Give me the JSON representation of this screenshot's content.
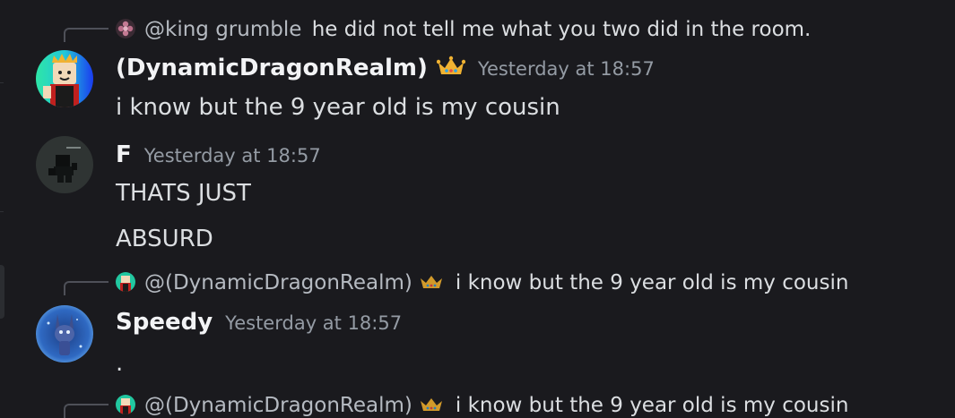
{
  "theme": {
    "background": "#1a1a1e",
    "text_primary": "#dbdee1",
    "username_color": "#f2f3f5",
    "timestamp_color": "#949ba4",
    "reply_spine_color": "#4e5058",
    "crown_color": "#f0b232"
  },
  "replies": [
    {
      "mention": "@king grumble",
      "text": "he did not tell me what you two did in the room.",
      "avatar_icon": "flower-avatar-icon",
      "crown": false
    },
    {
      "mention": "@(DynamicDragonRealm)",
      "text": "i know but the 9 year old is my  cousin",
      "avatar_icon": "roblox-avatar-icon",
      "crown": true
    },
    {
      "mention": "@(DynamicDragonRealm)",
      "text": "i know but the 9 year old is my  cousin",
      "avatar_icon": "roblox-avatar-icon",
      "crown": true
    }
  ],
  "messages": [
    {
      "username": "(DynamicDragonRealm)",
      "timestamp": "Yesterday at 18:57",
      "lines": [
        "i know but the 9 year old is my  cousin"
      ],
      "avatar_icon": "roblox-avatar-icon",
      "crown": true
    },
    {
      "username": "F",
      "timestamp": "Yesterday at 18:57",
      "lines": [
        "THATS JUST",
        "ABSURD"
      ],
      "avatar_icon": "dark-figure-avatar-icon",
      "crown": false
    },
    {
      "username": "Speedy",
      "timestamp": "Yesterday at 18:57",
      "lines": [
        "."
      ],
      "avatar_icon": "blue-animatronic-avatar-icon",
      "crown": false
    }
  ]
}
